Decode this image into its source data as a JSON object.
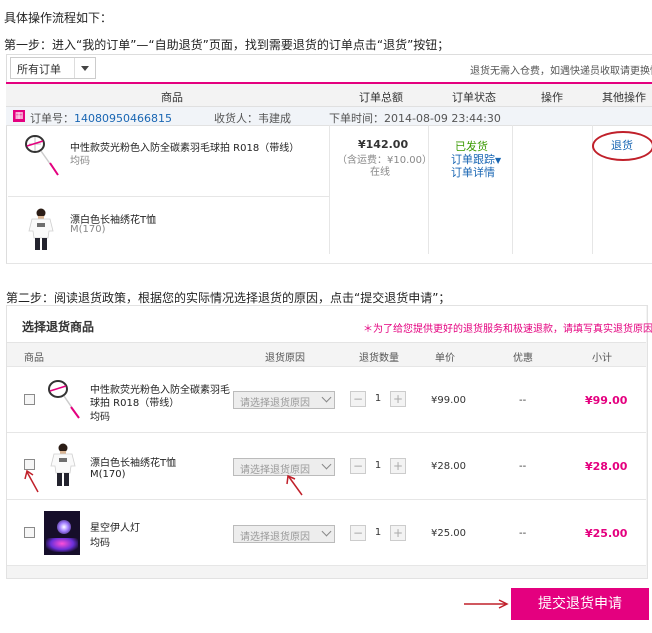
{
  "intro": "具体操作流程如下：",
  "step1": "第一步：进入“我的订单”—“自助退货”页面，找到需要退货的订单点击“退货”按钮；",
  "step2": "第二步：阅读退货政策，根据您的实际情况选择退货的原因，点击“提交退货申请”；",
  "orders_panel": {
    "filter_value": "所有订单",
    "notice": "退货无需入仓费，如遇快递员收取请更换快递",
    "headers": [
      "商品",
      "订单总额",
      "订单状态",
      "操作",
      "其他操作"
    ],
    "shop_icon": "ꚰ",
    "order_no_label": "订单号：",
    "order_no": "14080950466815",
    "receiver_label": "收货人：",
    "receiver": "韦建成",
    "time_label": "下单时间：",
    "time": "2014-08-09 23:44:30",
    "items": [
      {
        "name": "中性款荧光粉色入防全碳素羽毛球拍 R018（带线）",
        "size": "均码"
      },
      {
        "name": "漂白色长袖绣花T恤",
        "size": "M(170)"
      }
    ],
    "total": "¥142.00",
    "shipping": "（含运费：¥10.00）",
    "pay": "在线",
    "status": "已发货",
    "track": "订单跟踪",
    "detail": "订单详情",
    "return_link": "退货"
  },
  "return_panel": {
    "title": "选择退货商品",
    "note": "＊为了给您提供更好的退货服务和极速退款，请填写真实退货原因",
    "headers": {
      "product": "商品",
      "reason": "退货原因",
      "qty": "退货数量",
      "price": "单价",
      "discount": "优惠",
      "subtotal": "小计"
    },
    "reason_placeholder": "请选择退货原因",
    "rows": [
      {
        "name_line1": "中性款荧光粉色入防全碳素羽毛",
        "name_line2": "球拍 R018（带线）",
        "size": "均码",
        "qty": "1",
        "price": "¥99.00",
        "discount": "--",
        "subtotal": "¥99.00"
      },
      {
        "name_line1": "漂白色长袖绣花T恤",
        "name_line2": "",
        "size": "M(170)",
        "qty": "1",
        "price": "¥28.00",
        "discount": "--",
        "subtotal": "¥28.00"
      },
      {
        "name_line1": "星空伊人灯",
        "name_line2": "",
        "size": "均码",
        "qty": "1",
        "price": "¥25.00",
        "discount": "--",
        "subtotal": "¥25.00"
      }
    ],
    "submit_label": "提交退货申请"
  },
  "colors": {
    "accent": "#e4007f",
    "link": "#1966b3",
    "green": "#3a9a00",
    "annotation": "#c0202a"
  }
}
